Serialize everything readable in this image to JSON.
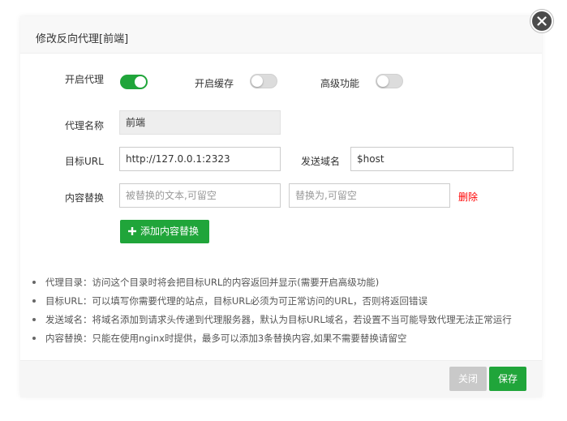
{
  "dialog": {
    "title": "修改反向代理[前端]"
  },
  "switches": {
    "enable_proxy": {
      "label": "开启代理",
      "on": true
    },
    "enable_cache": {
      "label": "开启缓存",
      "on": false
    },
    "advanced": {
      "label": "高级功能",
      "on": false
    }
  },
  "form": {
    "proxy_name": {
      "label": "代理名称",
      "value": "前端"
    },
    "target_url": {
      "label": "目标URL",
      "value": "http://127.0.0.1:2323"
    },
    "send_domain": {
      "label": "发送域名",
      "value": "$host"
    },
    "content_replace": {
      "label": "内容替换",
      "from_placeholder": "被替换的文本,可留空",
      "to_placeholder": "替换为,可留空",
      "delete_label": "删除"
    },
    "add_replace_button": "添加内容替换"
  },
  "tips": [
    "代理目录：访问这个目录时将会把目标URL的内容返回并显示(需要开启高级功能)",
    "目标URL：可以填写你需要代理的站点，目标URL必须为可正常访问的URL，否则将返回错误",
    "发送域名：将域名添加到请求头传递到代理服务器，默认为目标URL域名，若设置不当可能导致代理无法正常运行",
    "内容替换：只能在使用nginx时提供，最多可以添加3条替换内容,如果不需要替换请留空"
  ],
  "footer": {
    "close_label": "关闭",
    "save_label": "保存"
  },
  "colors": {
    "accent": "#20a53a",
    "delete": "#ff0000",
    "disabled_button": "#c9c9c9"
  },
  "icons": {
    "close": "close-icon",
    "add": "plus-icon"
  }
}
